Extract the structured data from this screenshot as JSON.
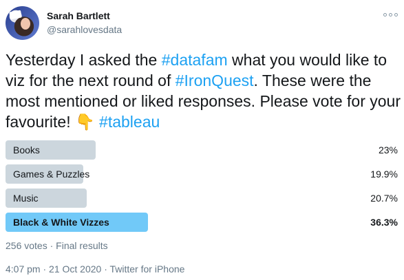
{
  "header": {
    "name": "Sarah Bartlett",
    "handle": "@sarahlovesdata"
  },
  "tweet": {
    "text_1": "Yesterday I asked the ",
    "hashtag_1": "#datafam",
    "text_2": " what you would like to viz for the next round of ",
    "hashtag_2": "#IronQuest",
    "text_3": ". These were the most mentioned or liked responses. Please vote for your favourite! ",
    "emoji": "👇",
    "hashtag_3": "#tableau"
  },
  "poll": {
    "options": [
      {
        "label": "Books",
        "percent": "23%",
        "value": 23,
        "winner": false
      },
      {
        "label": "Games & Puzzles",
        "percent": "19.9%",
        "value": 19.9,
        "winner": false
      },
      {
        "label": "Music",
        "percent": "20.7%",
        "value": 20.7,
        "winner": false
      },
      {
        "label": "Black & White Vizzes",
        "percent": "36.3%",
        "value": 36.3,
        "winner": true
      }
    ],
    "summary": "256 votes · Final results"
  },
  "footer": {
    "meta": "4:07 pm · 21 Oct 2020 · Twitter for iPhone"
  }
}
